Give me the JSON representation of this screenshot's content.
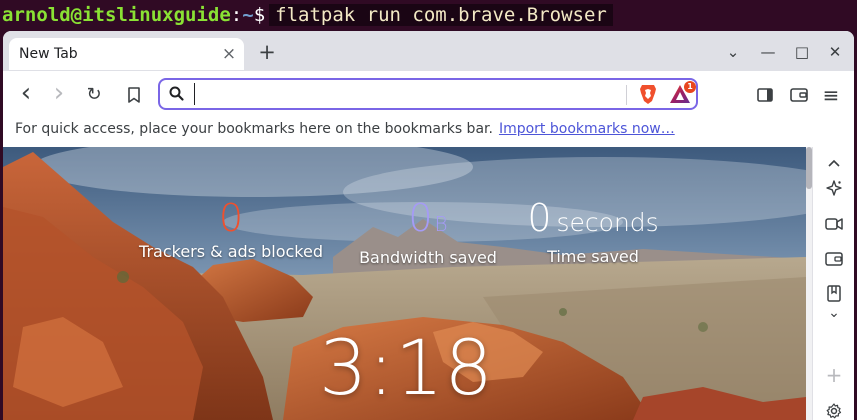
{
  "terminal": {
    "user_host": "arnold@itslinuxguide",
    "colon": ":",
    "path": "~",
    "prompt": "$",
    "command": "flatpak run com.brave.Browser"
  },
  "tabs": [
    {
      "title": "New Tab",
      "close_glyph": "×"
    }
  ],
  "tabbar": {
    "new_tab_glyph": "+"
  },
  "window_controls": {
    "dropdown_glyph": "⌄",
    "minimize_glyph": "—",
    "maximize_glyph": "□",
    "close_glyph": "✕"
  },
  "toolbar": {
    "back_glyph": "‹",
    "forward_glyph": "›",
    "reload_glyph": "↻",
    "address": {
      "value": "",
      "placeholder": ""
    },
    "rewards_badge_count": "1",
    "menu_glyph": "≡"
  },
  "bookmarks_bar": {
    "message": "For quick access, place your bookmarks here on the bookmarks bar.",
    "import_link": "Import bookmarks now…"
  },
  "new_tab_page": {
    "stats": [
      {
        "value": "0",
        "unit": "",
        "label": "Trackers & ads blocked",
        "color": "#f0502d"
      },
      {
        "value": "0",
        "unit": "B",
        "label": "Bandwidth saved",
        "color": "#a59bf5"
      },
      {
        "value": "0",
        "unit": "seconds",
        "label": "Time saved",
        "color": "#ffffff"
      }
    ],
    "clock": "3:18"
  },
  "sidebar": {
    "add_glyph": "+",
    "chevron_glyph": "⌄"
  },
  "colors": {
    "accent": "#7a66e6",
    "terminal_bg": "#300a24",
    "brave_orange": "#f0502d",
    "bandwidth_purple": "#a59bf5"
  }
}
